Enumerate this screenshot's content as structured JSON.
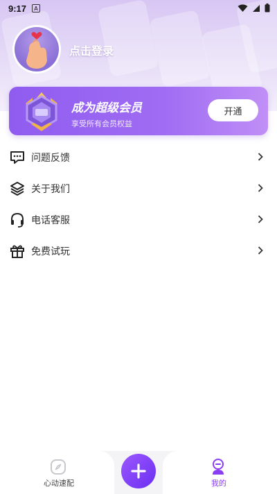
{
  "status_bar": {
    "time": "9:17",
    "notification_letter": "A"
  },
  "profile": {
    "login_label": "点击登录"
  },
  "vip": {
    "title": "成为超级会员",
    "subtitle": "享受所有会员权益",
    "button_label": "开通"
  },
  "menu": [
    {
      "label": "问题反馈",
      "icon": "feedback-icon"
    },
    {
      "label": "关于我们",
      "icon": "layers-icon"
    },
    {
      "label": "电话客服",
      "icon": "headset-icon"
    },
    {
      "label": "免费试玩",
      "icon": "gift-icon"
    }
  ],
  "tabbar": {
    "left_label": "心动速配",
    "right_label": "我的",
    "active_tab": "我的",
    "accent_color": "#8a3cf2"
  },
  "colors": {
    "accent": "#8a3cf2",
    "vip_gradient_start": "#8f5cf0",
    "vip_gradient_end": "#c08ff6"
  }
}
